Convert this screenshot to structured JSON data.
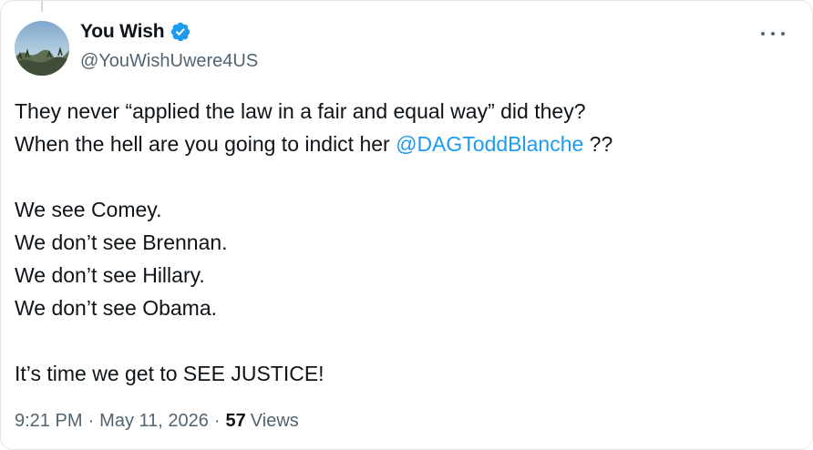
{
  "author": {
    "display_name": "You Wish",
    "handle": "@YouWishUwere4US",
    "verified": true,
    "verified_color": "#1d9bf0",
    "avatar_icon": "landscape-sky-avatar"
  },
  "more_icon": "ellipsis-icon",
  "tweet": {
    "line1": "They never “applied the law in a fair and equal way” did they?",
    "line2_prefix": "When the hell are you going to indict her ",
    "line2_mention": "@DAGToddBlanche",
    "line2_suffix": " ??",
    "line3": "We see Comey.",
    "line4": "We don’t see Brennan.",
    "line5": "We don’t see Hillary.",
    "line6": "We don’t see Obama.",
    "line7": "It’s time we get to SEE JUSTICE!"
  },
  "meta": {
    "time": "9:21 PM",
    "separator": "·",
    "date": "May 11, 2026",
    "views_count": "57",
    "views_label": "Views"
  },
  "colors": {
    "text": "#0f1419",
    "secondary": "#536471",
    "link": "#1d9bf0"
  }
}
